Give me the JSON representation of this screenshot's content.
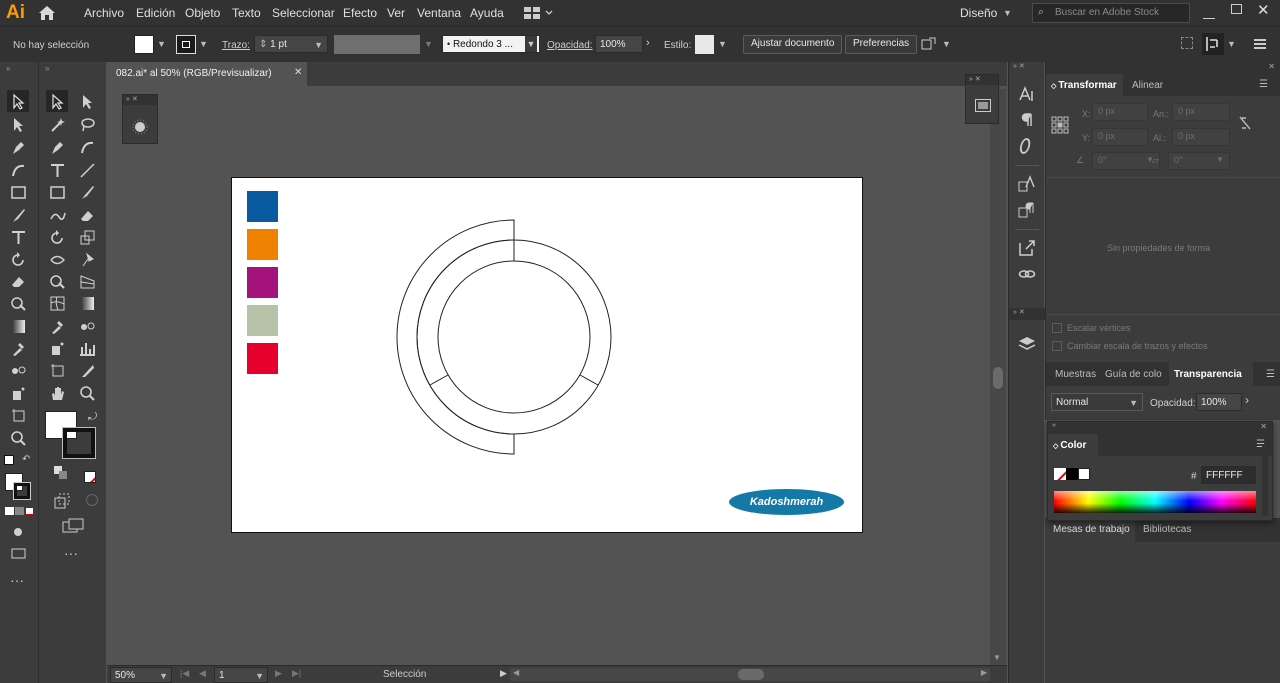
{
  "app": {
    "logo": "Ai"
  },
  "menu": [
    "Archivo",
    "Edición",
    "Objeto",
    "Texto",
    "Seleccionar",
    "Efecto",
    "Ver",
    "Ventana",
    "Ayuda"
  ],
  "workspace": "Diseño",
  "search_placeholder": "Buscar en Adobe Stock",
  "control": {
    "selection": "No hay selección",
    "stroke_label": "Trazo:",
    "stroke_value": "1 pt",
    "brush": "Redondo 3 ...",
    "opacity_label": "Opacidad:",
    "opacity_value": "100%",
    "style_label": "Estilo:",
    "adjust_button": "Ajustar documento",
    "prefs_button": "Preferencias"
  },
  "document_tab": {
    "title": "082.ai* al 50% (RGB/Previsualizar)"
  },
  "swatches": [
    "#0a5aa0",
    "#ef8200",
    "#a4127b",
    "#b7c2a8",
    "#e8002c"
  ],
  "artboard": {
    "logo_text": "Kadoshmerah",
    "logo_color": "#1479a6"
  },
  "transform": {
    "tabs": [
      "Transformar",
      "Alinear"
    ],
    "x_label": "X:",
    "x_value": "0 px",
    "y_label": "Y:",
    "y_value": "0 px",
    "w_label": "An.:",
    "w_value": "0 px",
    "h_label": "Al.:",
    "h_value": "0 px",
    "angle_value": "0°",
    "shear_value": "0°",
    "empty_msg": "Sin propiedades de forma",
    "scale_corners": "Escalar vértices",
    "scale_strokes": "Cambiar escala de trazos y efectos"
  },
  "transparency": {
    "tabs": [
      "Muestras",
      "Guía de colo",
      "Transparencia"
    ],
    "mode": "Normal",
    "opacity_label": "Opacidad:",
    "opacity_value": "100%"
  },
  "color_panel": {
    "title": "Color",
    "hash": "#",
    "hex_value": "FFFFFF"
  },
  "bottom_tabs": [
    "Mesas de trabajo",
    "Bibliotecas"
  ],
  "status": {
    "zoom": "50%",
    "page": "1",
    "tool": "Selección"
  }
}
